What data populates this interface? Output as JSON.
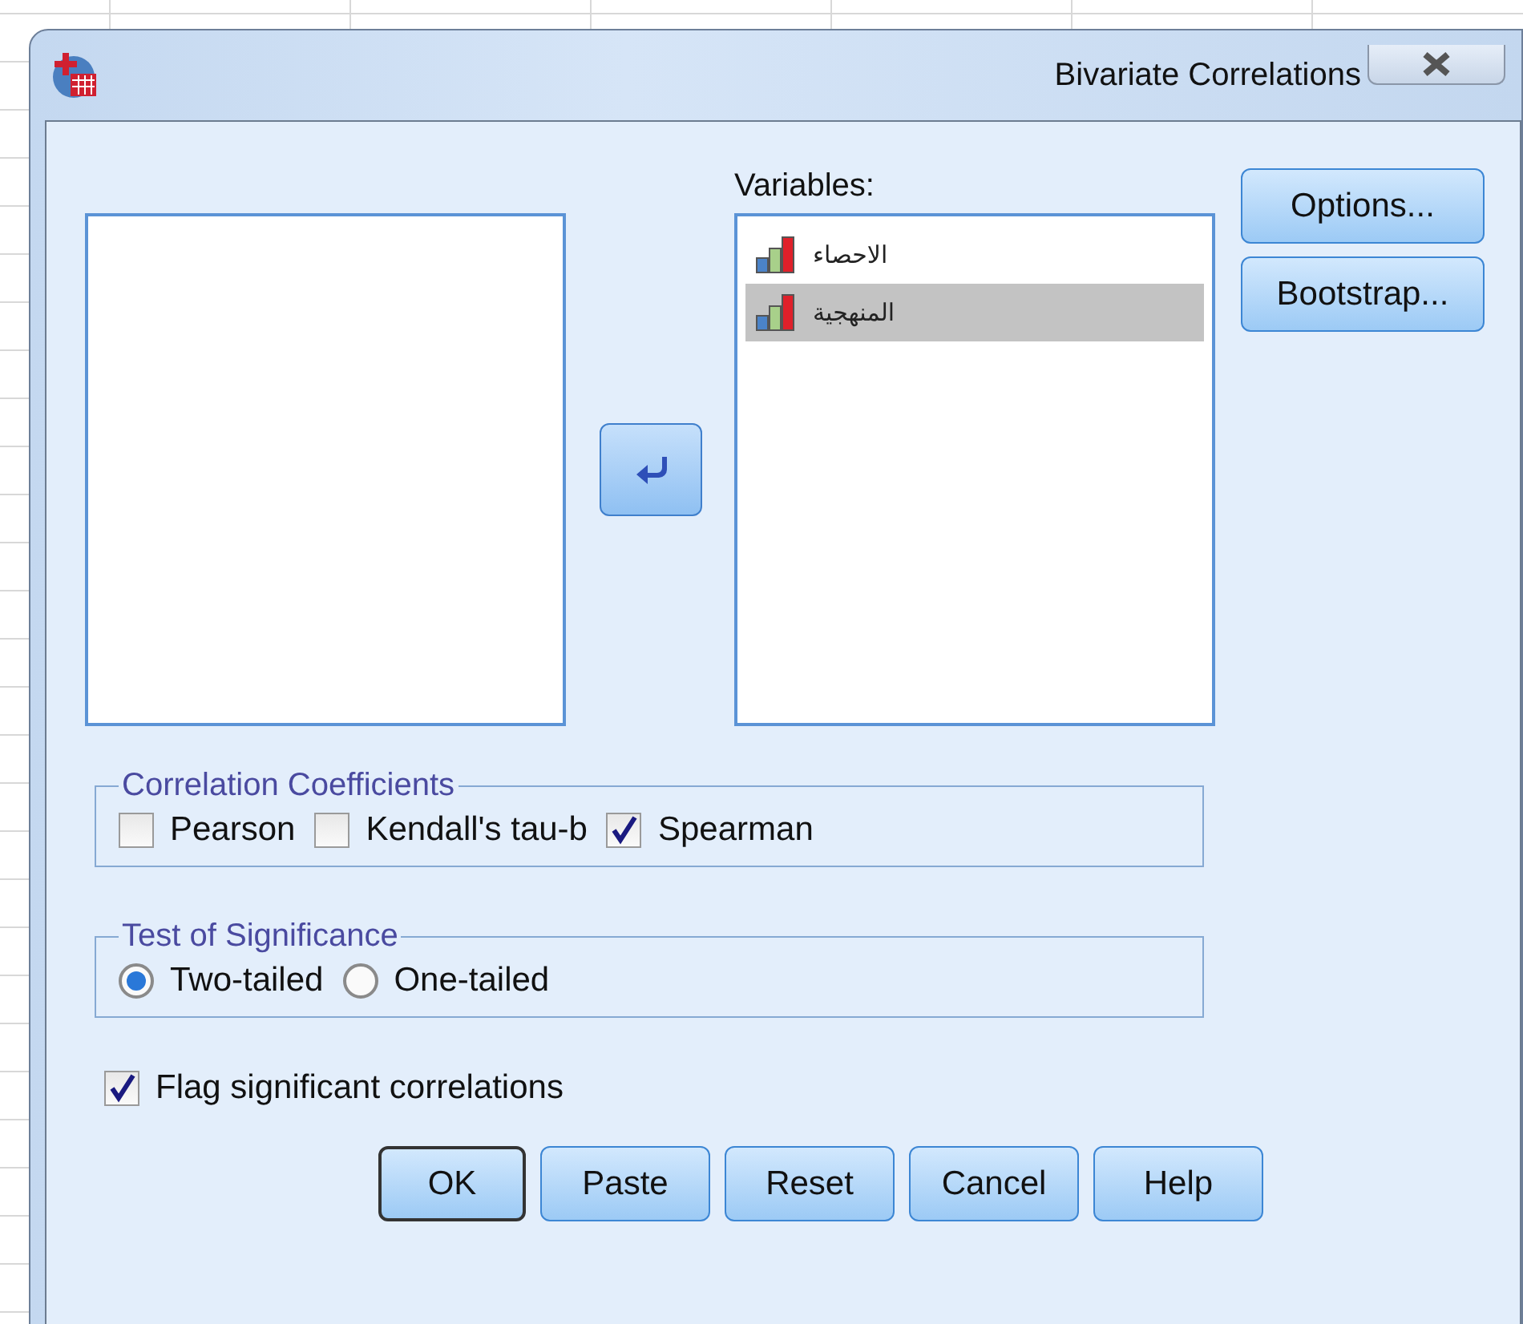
{
  "window": {
    "title": "Bivariate Correlations"
  },
  "variables": {
    "label": "Variables:",
    "items": [
      {
        "name": "الاحصاء",
        "selected": false
      },
      {
        "name": "المنهجية",
        "selected": true
      }
    ]
  },
  "side_buttons": [
    "Options...",
    "Bootstrap..."
  ],
  "correlation_coefficients": {
    "title": "Correlation Coefficients",
    "options": [
      {
        "label": "Pearson",
        "checked": false
      },
      {
        "label": "Kendall's tau-b",
        "checked": false
      },
      {
        "label": "Spearman",
        "checked": true
      }
    ]
  },
  "test_of_significance": {
    "title": "Test of Significance",
    "options": [
      {
        "label": "Two-tailed",
        "selected": true
      },
      {
        "label": "One-tailed",
        "selected": false
      }
    ]
  },
  "flag_significant": {
    "label": "Flag significant correlations",
    "checked": true
  },
  "buttons": [
    {
      "label": "OK",
      "default": true
    },
    {
      "label": "Paste",
      "default": false
    },
    {
      "label": "Reset",
      "default": false
    },
    {
      "label": "Cancel",
      "default": false
    },
    {
      "label": "Help",
      "default": false
    }
  ]
}
